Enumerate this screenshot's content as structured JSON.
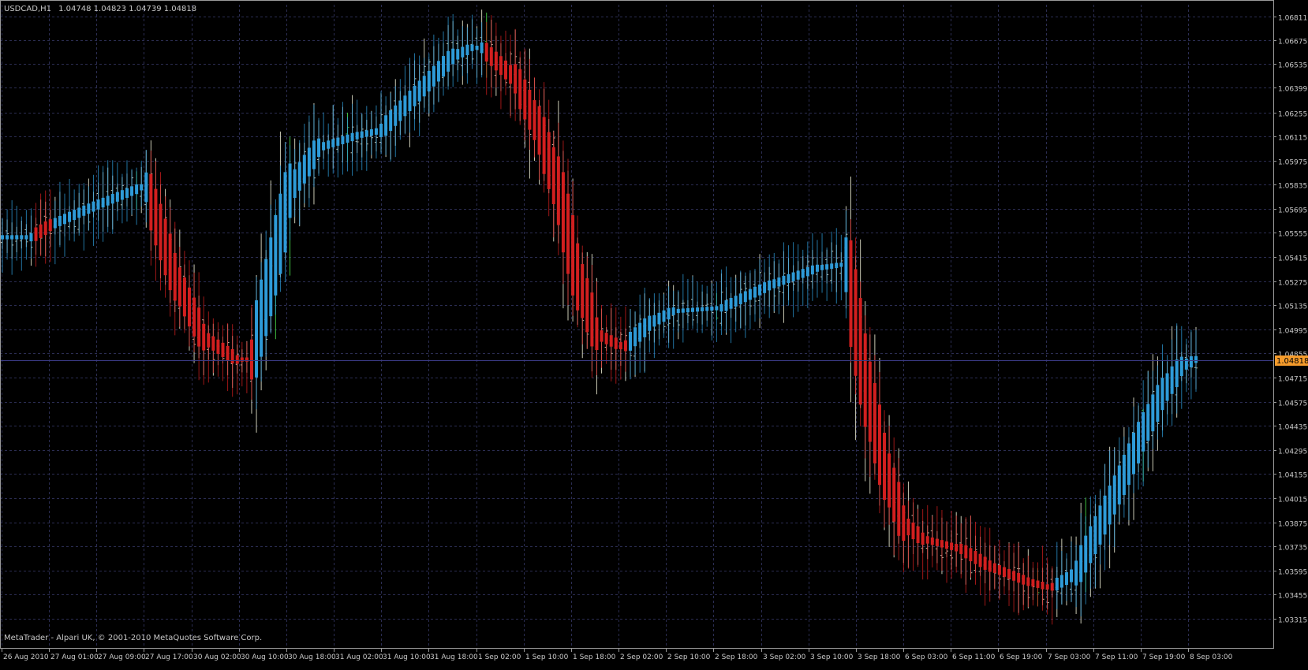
{
  "chart_header": {
    "symbol_timeframe": "USDCAD,H1",
    "ohlc": "1.04748 1.04823 1.04739 1.04818"
  },
  "footer_text": "MetaTrader - Alpari UK, © 2001-2010 MetaQuotes Software Corp.",
  "colors": {
    "background": "#000000",
    "frame": "#9a9a9a",
    "grid": "#2b2d52",
    "axis_text": "#c8c8c8",
    "up_bar": "#c9c9b4",
    "down_bar": "#c9c9b4",
    "doji_bar": "#3fbf3f",
    "ha_up": "#2e9bd8",
    "ha_down": "#d21f1f",
    "bid_line": "#3a3a85",
    "price_tag_bg": "#f59b2b",
    "price_tag_text": "#000000"
  },
  "chart_data": {
    "type": "ohlc_with_heiken_ashi",
    "symbol": "USDCAD",
    "timeframe": "H1",
    "current_price": 1.04818,
    "ylim": [
      1.0331,
      1.0688
    ],
    "price_ticks": [
      "1.06811",
      "1.06675",
      "1.06535",
      "1.06399",
      "1.06255",
      "1.06115",
      "1.05975",
      "1.05835",
      "1.05695",
      "1.05555",
      "1.05415",
      "1.05275",
      "1.05135",
      "1.04995",
      "1.04855",
      "1.04715",
      "1.04575",
      "1.04435",
      "1.04295",
      "1.04155",
      "1.04015",
      "1.03875",
      "1.03735",
      "1.03595",
      "1.03455",
      "1.03315"
    ],
    "time_ticks": [
      "26 Aug 2010",
      "27 Aug 01:00",
      "27 Aug 09:00",
      "27 Aug 17:00",
      "30 Aug 02:00",
      "30 Aug 10:00",
      "30 Aug 18:00",
      "31 Aug 02:00",
      "31 Aug 10:00",
      "31 Aug 18:00",
      "1 Sep 02:00",
      "1 Sep 10:00",
      "1 Sep 18:00",
      "2 Sep 02:00",
      "2 Sep 10:00",
      "2 Sep 18:00",
      "3 Sep 02:00",
      "3 Sep 10:00",
      "3 Sep 18:00",
      "6 Sep 03:00",
      "6 Sep 11:00",
      "6 Sep 19:00",
      "7 Sep 03:00",
      "7 Sep 11:00",
      "7 Sep 19:00",
      "8 Sep 03:00"
    ],
    "trend_path": [
      [
        0,
        1.0553,
        1
      ],
      [
        6,
        1.0553,
        -1
      ],
      [
        10,
        1.056,
        1
      ],
      [
        20,
        1.0572,
        1
      ],
      [
        29,
        1.0582,
        1
      ],
      [
        30,
        1.0582,
        -1
      ],
      [
        36,
        1.053,
        -1
      ],
      [
        42,
        1.0495,
        -1
      ],
      [
        49,
        1.0482,
        -1
      ],
      [
        52,
        1.0482,
        1
      ],
      [
        56,
        1.053,
        1
      ],
      [
        60,
        1.058,
        1
      ],
      [
        66,
        1.0605,
        1
      ],
      [
        74,
        1.0612,
        1
      ],
      [
        79,
        1.0615,
        1
      ],
      [
        86,
        1.0635,
        1
      ],
      [
        94,
        1.0658,
        1
      ],
      [
        98,
        1.0663,
        1
      ],
      [
        100,
        1.0663,
        -1
      ],
      [
        107,
        1.0645,
        -1
      ],
      [
        112,
        1.0615,
        -1
      ],
      [
        116,
        1.058,
        -1
      ],
      [
        120,
        1.053,
        -1
      ],
      [
        124,
        1.0497,
        -1
      ],
      [
        129,
        1.049,
        -1
      ],
      [
        130,
        1.049,
        1
      ],
      [
        135,
        1.0503,
        1
      ],
      [
        140,
        1.051,
        1
      ],
      [
        150,
        1.0512,
        1
      ],
      [
        160,
        1.0525,
        1
      ],
      [
        170,
        1.0535,
        1
      ],
      [
        175,
        1.0537,
        1
      ],
      [
        176,
        1.0537,
        -1
      ],
      [
        180,
        1.047,
        -1
      ],
      [
        184,
        1.042,
        -1
      ],
      [
        188,
        1.0387,
        -1
      ],
      [
        192,
        1.0378,
        -1
      ],
      [
        200,
        1.0372,
        -1
      ],
      [
        206,
        1.0362,
        -1
      ],
      [
        214,
        1.0353,
        -1
      ],
      [
        218,
        1.035,
        -1
      ],
      [
        219,
        1.035,
        1
      ],
      [
        224,
        1.0358,
        1
      ],
      [
        228,
        1.038,
        1
      ],
      [
        234,
        1.0415,
        1
      ],
      [
        238,
        1.044,
        1
      ],
      [
        242,
        1.0462,
        1
      ],
      [
        246,
        1.0478,
        1
      ],
      [
        249,
        1.0482,
        1
      ]
    ]
  }
}
